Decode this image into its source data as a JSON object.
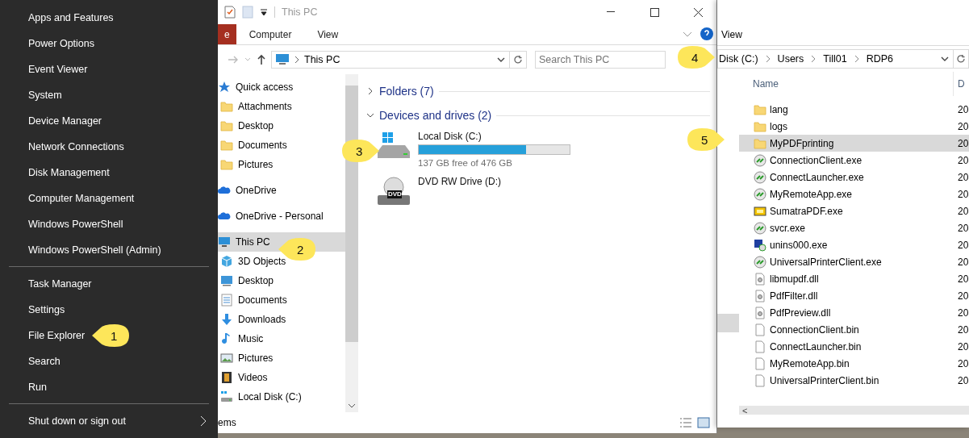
{
  "start_menu": {
    "groups": [
      [
        {
          "label": "Apps and Features"
        },
        {
          "label": "Power Options"
        },
        {
          "label": "Event Viewer"
        },
        {
          "label": "System"
        },
        {
          "label": "Device Manager"
        },
        {
          "label": "Network Connections"
        },
        {
          "label": "Disk Management"
        },
        {
          "label": "Computer Management"
        },
        {
          "label": "Windows PowerShell"
        },
        {
          "label": "Windows PowerShell (Admin)"
        }
      ],
      [
        {
          "label": "Task Manager"
        },
        {
          "label": "Settings"
        },
        {
          "label": "File Explorer"
        },
        {
          "label": "Search"
        },
        {
          "label": "Run"
        }
      ],
      [
        {
          "label": "Shut down or sign out",
          "submenu": true
        }
      ]
    ]
  },
  "explorer": {
    "title": "This PC",
    "ribbon_tabs": [
      {
        "label": "e",
        "selected": true
      },
      {
        "label": "Computer",
        "selected": false
      },
      {
        "label": "View",
        "selected": false
      }
    ],
    "address": "This PC",
    "search": {
      "placeholder": "Search This PC"
    },
    "nav_groups": [
      [
        {
          "label": "Quick access",
          "kind": "star",
          "selected": false,
          "children": [
            {
              "label": "Attachments",
              "kind": "folder",
              "selected": false
            },
            {
              "label": "Desktop",
              "kind": "folder",
              "selected": false
            },
            {
              "label": "Documents",
              "kind": "folder",
              "selected": false
            },
            {
              "label": "Pictures",
              "kind": "folder",
              "selected": false
            }
          ]
        }
      ],
      [
        {
          "label": "OneDrive",
          "kind": "cloud",
          "selected": false
        }
      ],
      [
        {
          "label": "OneDrive - Personal",
          "kind": "cloud",
          "selected": false
        }
      ],
      [
        {
          "label": "This PC",
          "kind": "pc",
          "selected": true,
          "children": [
            {
              "label": "3D Objects",
              "kind": "objects",
              "selected": false
            },
            {
              "label": "Desktop",
              "kind": "desktop",
              "selected": false
            },
            {
              "label": "Documents",
              "kind": "documents",
              "selected": false
            },
            {
              "label": "Downloads",
              "kind": "downloads",
              "selected": false
            },
            {
              "label": "Music",
              "kind": "music",
              "selected": false
            },
            {
              "label": "Pictures",
              "kind": "pictures",
              "selected": false
            },
            {
              "label": "Videos",
              "kind": "videos",
              "selected": false
            },
            {
              "label": "Local Disk (C:)",
              "kind": "disk",
              "selected": false
            }
          ]
        }
      ]
    ],
    "sections": [
      {
        "title": "Folders (7)",
        "expanded": false
      },
      {
        "title": "Devices and drives (2)",
        "expanded": true,
        "drives": [
          {
            "name": "Local Disk (C:)",
            "kind": "disk",
            "level": 0.71,
            "free": "137 GB free of 476 GB"
          },
          {
            "name": "DVD RW Drive (D:)",
            "kind": "dvd",
            "badge": "DVD"
          }
        ]
      }
    ],
    "status": "ems"
  },
  "second_window": {
    "tab": "View",
    "breadcrumb": [
      "Disk (C:)",
      "Users",
      "Till01",
      "RDP6"
    ],
    "columns": [
      "Name",
      "D"
    ],
    "files": [
      {
        "name": "lang",
        "kind": "folder",
        "date": "20",
        "selected": false
      },
      {
        "name": "logs",
        "kind": "folder",
        "date": "20",
        "selected": false
      },
      {
        "name": "MyPDFprinting",
        "kind": "folder",
        "date": "20",
        "selected": true
      },
      {
        "name": "ConnectionClient.exe",
        "kind": "remote",
        "date": "20",
        "selected": false
      },
      {
        "name": "ConnectLauncher.exe",
        "kind": "remote",
        "date": "20",
        "selected": false
      },
      {
        "name": "MyRemoteApp.exe",
        "kind": "remote",
        "date": "20",
        "selected": false
      },
      {
        "name": "SumatraPDF.exe",
        "kind": "pdf",
        "date": "20",
        "selected": false
      },
      {
        "name": "svcr.exe",
        "kind": "remote",
        "date": "20",
        "selected": false
      },
      {
        "name": "unins000.exe",
        "kind": "installer",
        "date": "20",
        "selected": false
      },
      {
        "name": "UniversalPrinterClient.exe",
        "kind": "remote",
        "date": "20",
        "selected": false
      },
      {
        "name": "libmupdf.dll",
        "kind": "dll",
        "date": "20",
        "selected": false
      },
      {
        "name": "PdfFilter.dll",
        "kind": "dll",
        "date": "20",
        "selected": false
      },
      {
        "name": "PdfPreview.dll",
        "kind": "dll",
        "date": "20",
        "selected": false
      },
      {
        "name": "ConnectionClient.bin",
        "kind": "file",
        "date": "20",
        "selected": false
      },
      {
        "name": "ConnectLauncher.bin",
        "kind": "file",
        "date": "20",
        "selected": false
      },
      {
        "name": "MyRemoteApp.bin",
        "kind": "file",
        "date": "20",
        "selected": false
      },
      {
        "name": "UniversalPrinterClient.bin",
        "kind": "file",
        "date": "20",
        "selected": false
      }
    ],
    "scroll_arrow": "<"
  },
  "callouts": [
    {
      "number": "1"
    },
    {
      "number": "2"
    },
    {
      "number": "3"
    },
    {
      "number": "4"
    },
    {
      "number": "5"
    }
  ]
}
